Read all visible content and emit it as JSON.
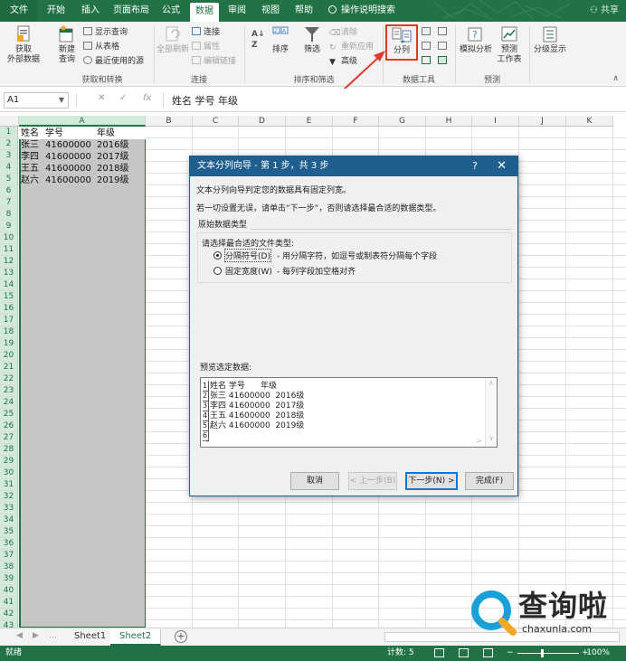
{
  "ribbon_tabs": [
    "文件",
    "开始",
    "插入",
    "页面布局",
    "公式",
    "数据",
    "审阅",
    "视图",
    "帮助"
  ],
  "active_tab": "数据",
  "tell_me": "操作说明搜索",
  "share": "共享",
  "ribbon": {
    "get_data_label": "获取\n外部数据",
    "new_query_label": "新建\n查询",
    "show_query": "显示查询",
    "from_table": "从表格",
    "recent_sources": "最近使用的源",
    "group_get_transform": "获取和转换",
    "refresh_all": "全部刷新",
    "connections": "连接",
    "properties": "属性",
    "edit_links": "编辑链接",
    "group_connections": "连接",
    "sort": "排序",
    "filter": "筛选",
    "clear": "清除",
    "reapply": "重新应用",
    "advanced": "高级",
    "group_sort_filter": "排序和筛选",
    "text_to_columns": "分列",
    "group_data_tools": "数据工具",
    "what_if": "模拟分析",
    "forecast_sheet": "预测\n工作表",
    "group_forecast": "预测",
    "outline": "分级显示"
  },
  "formula_bar": {
    "name_box": "A1",
    "formula": "姓名 学号    年级"
  },
  "columns": [
    "A",
    "B",
    "C",
    "D",
    "E",
    "F",
    "G",
    "H",
    "I",
    "J",
    "K"
  ],
  "row_numbers": [
    "1",
    "2",
    "3",
    "4",
    "5",
    "6",
    "7",
    "8",
    "9",
    "10",
    "11",
    "12",
    "13",
    "14",
    "15",
    "16",
    "17",
    "18",
    "19",
    "20",
    "21",
    "22",
    "23",
    "24",
    "25",
    "26",
    "27",
    "28",
    "29",
    "30",
    "31",
    "32",
    "33",
    "34",
    "35",
    "36",
    "37",
    "38",
    "39",
    "40",
    "41",
    "42",
    "43"
  ],
  "cells": [
    [
      "姓名",
      "学号",
      "年级"
    ],
    [
      "张三",
      "41600000",
      "2016级"
    ],
    [
      "李四",
      "41600000",
      "2017级"
    ],
    [
      "王五",
      "41600000",
      "2018级"
    ],
    [
      "赵六",
      "41600000",
      "2019级"
    ]
  ],
  "dialog": {
    "title": "文本分列向导 - 第 1 步，共 3 步",
    "help": "?",
    "close": "✕",
    "intro1": "文本分列向导判定您的数据具有固定列宽。",
    "intro2": "若一切设置无误，请单击“下一步”，否则请选择最合适的数据类型。",
    "fieldset_label": "原始数据类型",
    "choose_label": "请选择最合适的文件类型:",
    "option_delimited": "分隔符号(D)",
    "option_delimited_desc": "- 用分隔字符，如逗号或制表符分隔每个字段",
    "option_fixed": "固定宽度(W)",
    "option_fixed_desc": "- 每列字段加空格对齐",
    "preview_label": "预览选定数据:",
    "preview_rows": [
      {
        "n": "1",
        "text": "姓名 学号      年级"
      },
      {
        "n": "2",
        "text": "张三 41600000  2016级"
      },
      {
        "n": "3",
        "text": "李四 41600000  2017级"
      },
      {
        "n": "4",
        "text": "王五 41600000  2018级"
      },
      {
        "n": "5",
        "text": "赵六 41600000  2019级"
      },
      {
        "n": "6",
        "text": ""
      }
    ],
    "btn_cancel": "取消",
    "btn_back": "< 上一步(B)",
    "btn_next": "下一步(N) >",
    "btn_finish": "完成(F)"
  },
  "sheets": [
    "Sheet1",
    "Sheet2"
  ],
  "active_sheet": "Sheet2",
  "status": {
    "ready": "就绪",
    "count": "计数: 5",
    "zoom": "100%"
  },
  "watermark": {
    "cn": "查询啦",
    "en": "chaxunla.com"
  },
  "colors": {
    "excel_green": "#217346",
    "dialog_title": "#1f5f8f",
    "highlight_red": "#e03a2f",
    "selection_gray": "#c6c6c6"
  }
}
